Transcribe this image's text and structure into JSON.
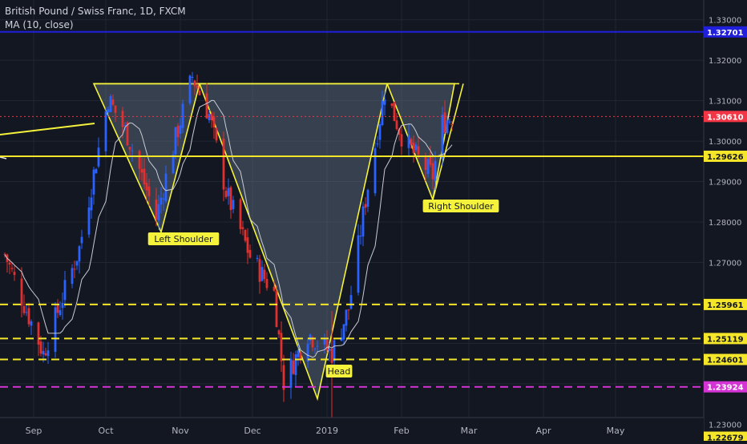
{
  "header": {
    "symbol_title": "British Pound / Swiss Franc, 1D, FXCM",
    "indicator_label": "MA (10, close)"
  },
  "colors": {
    "background": "#131722",
    "grid": "#222632",
    "candle_up": "#2962ff",
    "candle_down": "#e0302f",
    "ma_line": "#c9ccd6",
    "pattern_yellow": "#f4f23a",
    "support_yellow": "#f5e62a",
    "magenta_level": "#d534d4",
    "blue_level": "#1f1fdc",
    "current_price": "#f23645",
    "axis_text": "#b2b5be"
  },
  "price_axis": {
    "ticks": [
      "1.33000",
      "1.32000",
      "1.31000",
      "1.30000",
      "1.29000",
      "1.28000",
      "1.27000",
      "1.23000"
    ],
    "range": [
      1.2259,
      1.3349
    ]
  },
  "time_axis": {
    "labels": [
      "Sep",
      "Oct",
      "Nov",
      "Dec",
      "2019",
      "Feb",
      "Mar",
      "Apr",
      "May"
    ]
  },
  "levels": [
    {
      "label": "1.32701",
      "price": 1.32701,
      "style": "solid",
      "color": "blue_level"
    },
    {
      "label": "1.30610",
      "price": 1.3061,
      "style": "dotted",
      "color": "current_price"
    },
    {
      "label": "1.29626",
      "price": 1.29626,
      "style": "solid",
      "color": "support_yellow"
    },
    {
      "label": "1.25961",
      "price": 1.25961,
      "style": "dashed",
      "color": "support_yellow"
    },
    {
      "label": "1.25119",
      "price": 1.25119,
      "style": "dashed",
      "color": "support_yellow"
    },
    {
      "label": "1.24601",
      "price": 1.24601,
      "style": "dashed",
      "color": "support_yellow"
    },
    {
      "label": "1.23924",
      "price": 1.23924,
      "style": "dashed",
      "color": "magenta_level"
    },
    {
      "label": "1.22679",
      "price": 1.22679,
      "style": "dashed",
      "color": "support_yellow"
    }
  ],
  "annotations": {
    "left_shoulder": "Left Shoulder",
    "head": "Head",
    "right_shoulder": "Right Shoulder"
  },
  "chart_data": {
    "type": "candlestick",
    "title": "British Pound / Swiss Franc, 1D, FXCM",
    "series": [
      {
        "name": "MA (10, close)"
      }
    ],
    "ylim": [
      1.2259,
      1.3349
    ],
    "price_key_points": [
      {
        "date": "2018-08-20",
        "close": 1.272
      },
      {
        "date": "2018-09-05",
        "close": 1.2475
      },
      {
        "date": "2018-09-20",
        "close": 1.2735
      },
      {
        "date": "2018-10-02",
        "close": 1.3105
      },
      {
        "date": "2018-10-10",
        "close": 1.3015
      },
      {
        "date": "2018-10-22",
        "close": 1.281
      },
      {
        "date": "2018-10-29",
        "close": 1.2985
      },
      {
        "date": "2018-11-06",
        "close": 1.316
      },
      {
        "date": "2018-11-13",
        "close": 1.3065
      },
      {
        "date": "2018-11-20",
        "close": 1.2875
      },
      {
        "date": "2018-11-30",
        "close": 1.2715
      },
      {
        "date": "2018-12-10",
        "close": 1.2625
      },
      {
        "date": "2018-12-14",
        "close": 1.2405
      },
      {
        "date": "2018-12-24",
        "close": 1.2525
      },
      {
        "date": "2019-01-03",
        "close": 1.2475
      },
      {
        "date": "2019-01-10",
        "close": 1.2585
      },
      {
        "date": "2019-01-17",
        "close": 1.2855
      },
      {
        "date": "2019-01-25",
        "close": 1.3125
      },
      {
        "date": "2019-02-01",
        "close": 1.3015
      },
      {
        "date": "2019-02-06",
        "close": 1.297
      },
      {
        "date": "2019-02-14",
        "close": 1.2915
      },
      {
        "date": "2019-02-18",
        "close": 1.3045
      },
      {
        "date": "2019-02-22",
        "close": 1.3061
      }
    ]
  }
}
